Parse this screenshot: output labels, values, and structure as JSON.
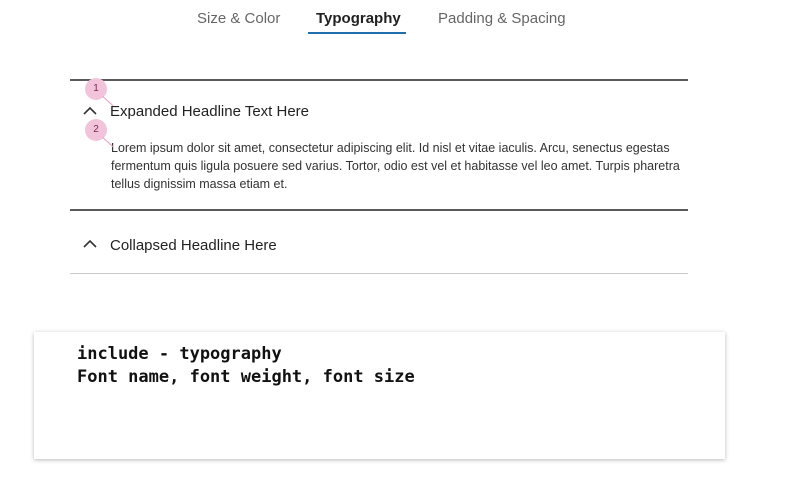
{
  "tabs": [
    {
      "label": "Size & Color"
    },
    {
      "label": "Typography"
    },
    {
      "label": "Padding & Spacing"
    }
  ],
  "active_tab": "Typography",
  "accent_color": "#1f6fad",
  "accordion": {
    "items": [
      {
        "headline": "Expanded Headline Text Here",
        "state": "expanded",
        "body": "Lorem ipsum dolor sit amet, consectetur adipiscing elit. Id nisl et vitae iaculis. Arcu, senectus egestas fermentum quis ligula posuere sed varius. Tortor, odio est vel et habitasse vel leo amet. Turpis pharetra tellus dignissim massa etiam et."
      },
      {
        "headline": "Collapsed Headline Here",
        "state": "collapsed"
      }
    ],
    "chevron_icon": "chevron-up-icon"
  },
  "markers": [
    {
      "label": "1"
    },
    {
      "label": "2"
    }
  ],
  "marker_color": "#f2c4dc",
  "note": {
    "line1": "include - typography",
    "line2": "Font name, font weight, font size"
  }
}
